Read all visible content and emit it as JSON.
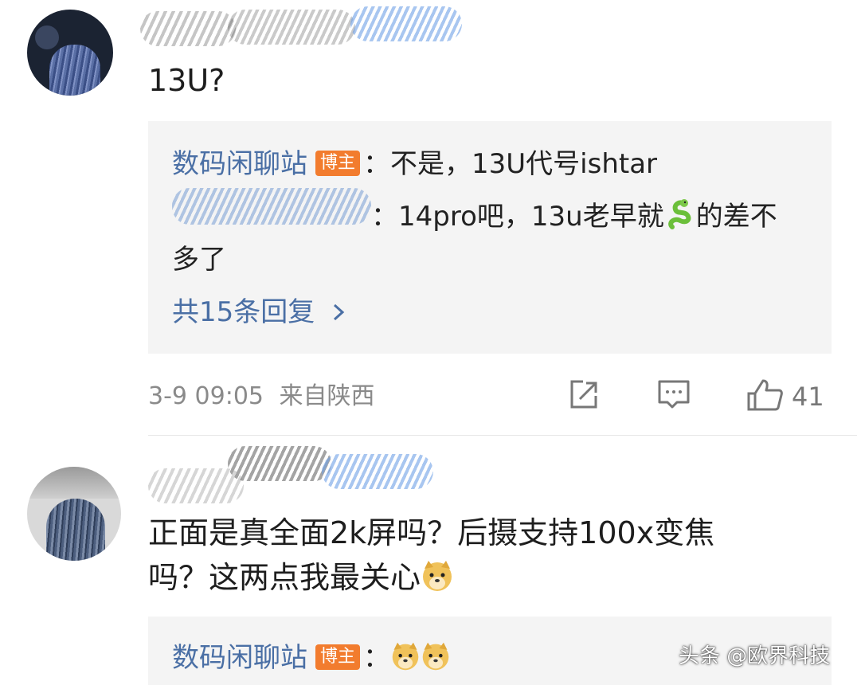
{
  "comments": [
    {
      "text": "13U?",
      "replies": [
        {
          "author": "数码闲聊站",
          "badge": "博主",
          "separator": "：",
          "text": "不是，13U代号ishtar"
        },
        {
          "separator": "：",
          "text_before_emoji": "14pro吧，13u老早就",
          "emoji": "snake-emoji",
          "text_after_emoji": "的差不",
          "text_wrap": "多了"
        }
      ],
      "more_replies": "共15条回复",
      "time": "3-9 09:05",
      "location": "来自陕西",
      "actions": {
        "share_icon": "share-icon",
        "comment_icon": "comment-icon",
        "like_icon": "like-icon"
      },
      "likes": "41"
    },
    {
      "text_line1": "正面是真全面2k屏吗？后摄支持100x变焦",
      "text_line2": "吗？这两点我最关心",
      "emoji": "doge-emoji",
      "replies": [
        {
          "author": "数码闲聊站",
          "badge": "博主",
          "separator": "：",
          "emojis": [
            "doge-emoji",
            "doge-emoji"
          ]
        }
      ]
    }
  ],
  "watermark": "头条 @欧界科技",
  "colors": {
    "link": "#4a6fa5",
    "badge": "#f27c2e",
    "reply_bg": "#f4f4f4",
    "meta": "#8a8a8a"
  }
}
